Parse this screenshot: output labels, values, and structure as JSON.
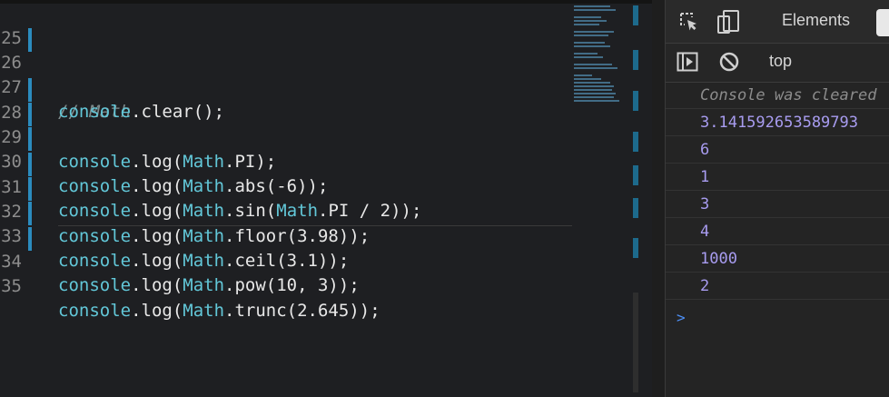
{
  "editor": {
    "lines": [
      {
        "num": "25",
        "text": "",
        "mark": false
      },
      {
        "num": "26",
        "text": "// Math",
        "mark": true
      },
      {
        "num": "27",
        "text": "console.clear();",
        "mark": false
      },
      {
        "num": "28",
        "text": "console.log(Math.PI);",
        "mark": true
      },
      {
        "num": "29",
        "text": "console.log(Math.abs(-6));",
        "mark": true
      },
      {
        "num": "30",
        "text": "console.log(Math.sin(Math.PI / 2));",
        "mark": true
      },
      {
        "num": "31",
        "text": "console.log(Math.floor(3.98));",
        "mark": true
      },
      {
        "num": "32",
        "text": "console.log(Math.ceil(3.1));",
        "mark": true
      },
      {
        "num": "33",
        "text": "console.log(Math.pow(10, 3));",
        "mark": true
      },
      {
        "num": "34",
        "text": "console.log(Math.trunc(2.645));",
        "mark": true
      },
      {
        "num": "35",
        "text": "",
        "mark": false
      }
    ]
  },
  "devtools": {
    "tab_elements": "Elements",
    "inspect_icon": "inspect-element-icon",
    "device_icon": "device-toolbar-icon",
    "sidebar_icon": "show-sidebar-icon",
    "clear_icon": "clear-console-icon",
    "context": "top",
    "cleared_message": "Console was cleared",
    "outputs": [
      "3.141592653589793",
      "6",
      "1",
      "3",
      "4",
      "1000",
      "2"
    ],
    "prompt": ">"
  },
  "colors": {
    "accent_blue": "#2b8bbe",
    "console_value": "#a89cf0",
    "object_token": "#62c7d8"
  }
}
